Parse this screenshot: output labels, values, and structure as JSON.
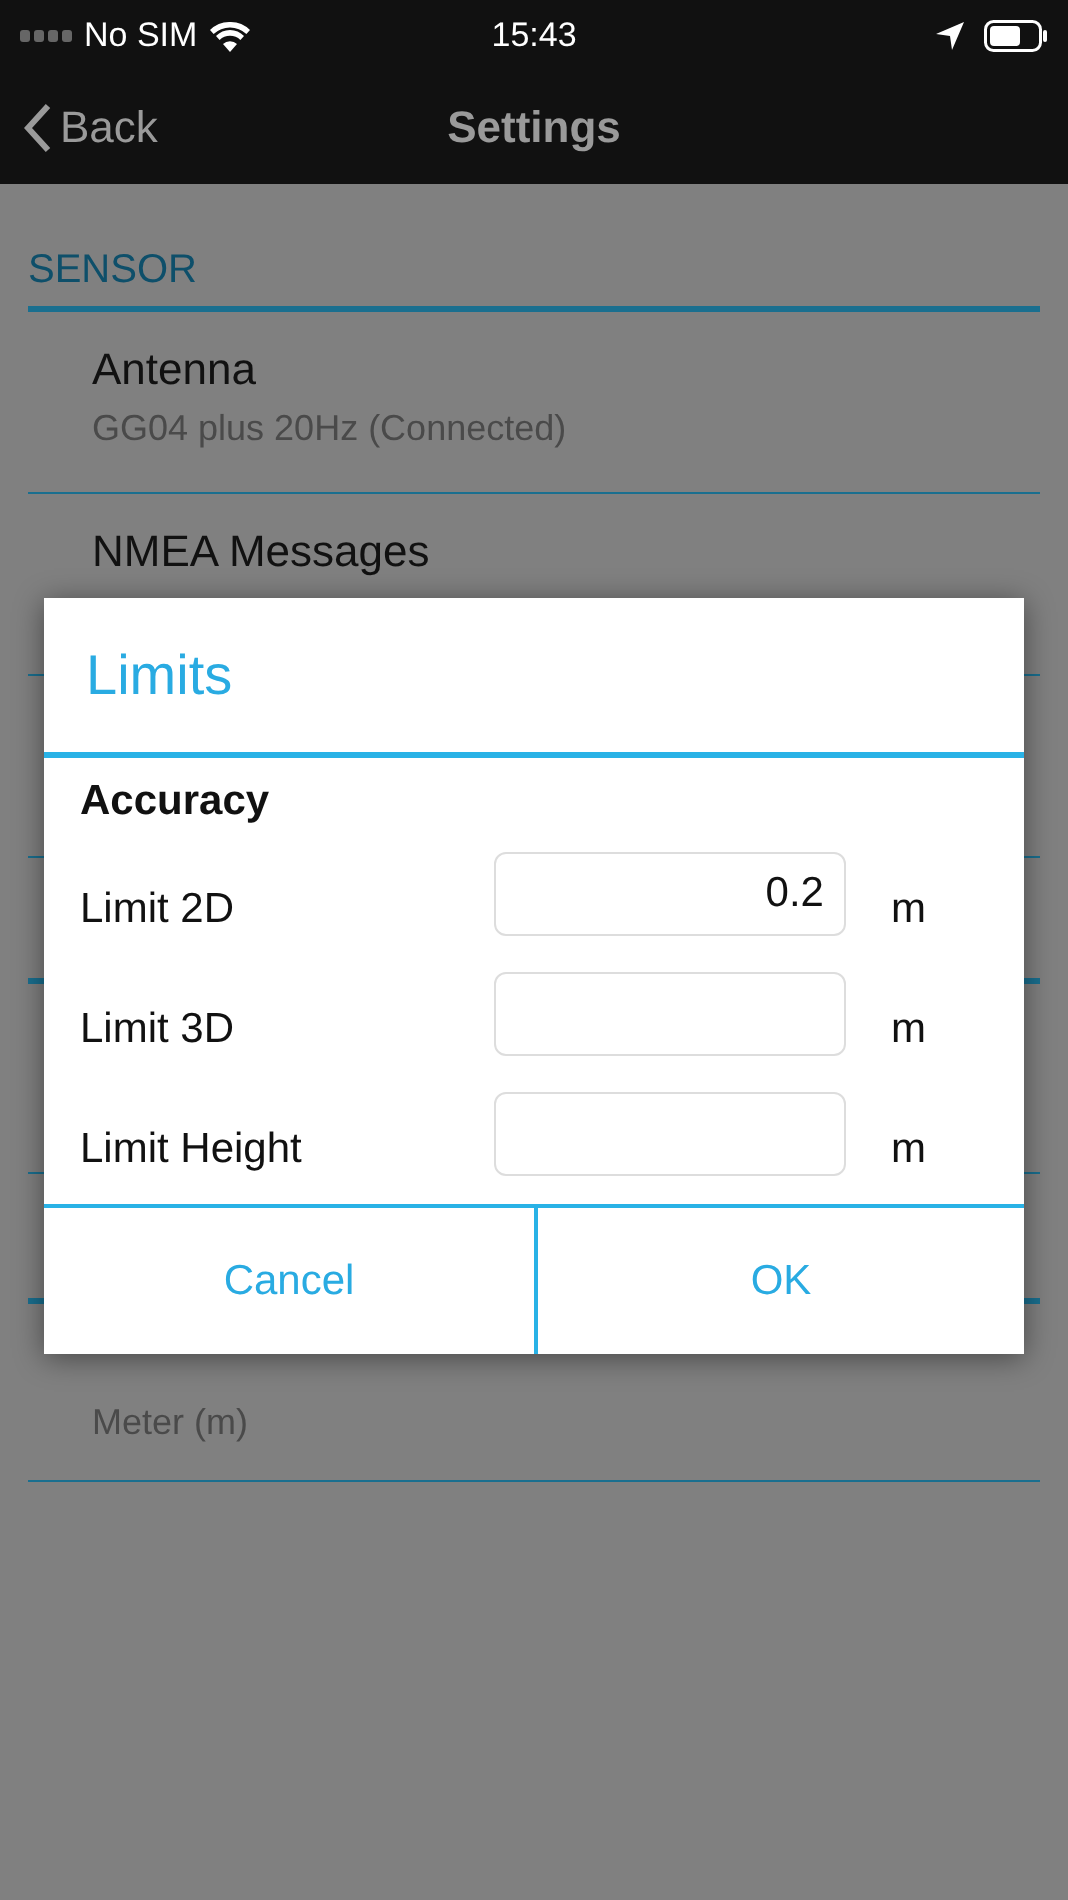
{
  "status_bar": {
    "carrier": "No SIM",
    "time": "15:43"
  },
  "nav_bar": {
    "back": "Back",
    "title": "Settings"
  },
  "settings": {
    "sections": [
      {
        "title": "SENSOR",
        "items": [
          {
            "title": "Antenna",
            "subtitle": "GG04 plus 20Hz (Connected)"
          },
          {
            "title": "NMEA Messages"
          }
        ]
      }
    ],
    "unit_row": {
      "subtitle": "Meter (m)"
    }
  },
  "dialog": {
    "title": "Limits",
    "group": "Accuracy",
    "fields": [
      {
        "label": "Limit 2D",
        "value": "0.2",
        "unit": "m"
      },
      {
        "label": "Limit 3D",
        "unit": "m"
      },
      {
        "label": "Limit Height",
        "unit": "m"
      }
    ],
    "buttons": [
      "Cancel",
      "OK"
    ]
  }
}
